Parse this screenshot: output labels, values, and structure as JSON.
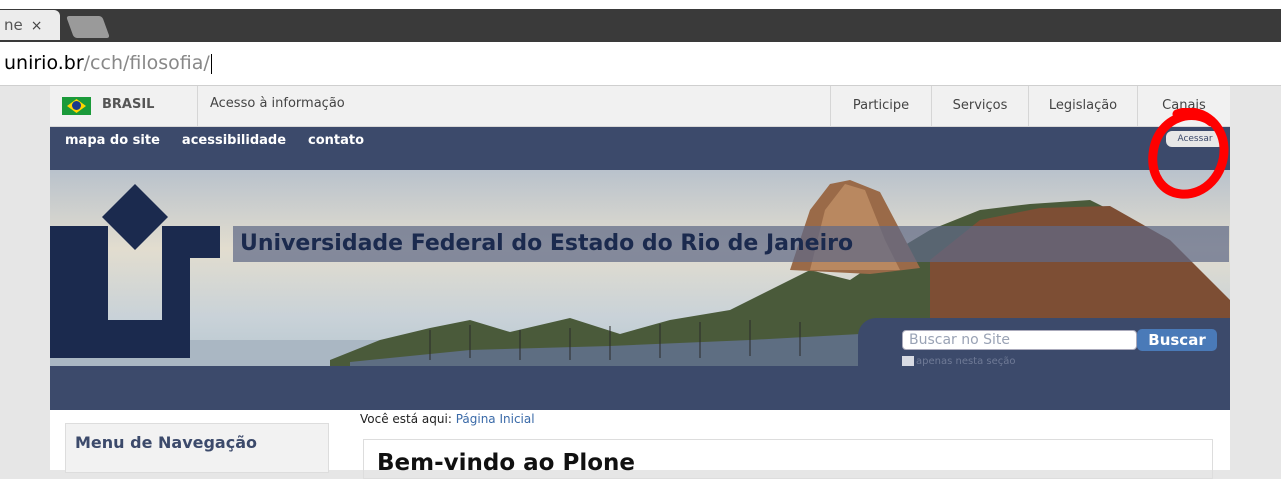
{
  "browser": {
    "tab_label": "ne",
    "tab_close": "×",
    "url_domain": "unirio.br",
    "url_path": "/cch/filosofia/"
  },
  "govbar": {
    "brasil_label": "BRASIL",
    "acesso_label": "Acesso à informação",
    "links": [
      "Participe",
      "Serviços",
      "Legislação",
      "Canais"
    ]
  },
  "header": {
    "top_links": [
      "mapa do site",
      "acessibilidade",
      "contato"
    ],
    "acessar_label": "Acessar",
    "site_title": "Universidade Federal do Estado do Rio de Janeiro"
  },
  "search": {
    "placeholder": "Buscar no Site",
    "button_label": "Buscar",
    "checkbox_label": "apenas nesta seção"
  },
  "content": {
    "breadcrumb_prefix": "Você está aqui:",
    "breadcrumb_link": "Página Inicial",
    "nav_menu_title": "Menu de Navegação",
    "welcome_title": "Bem-vindo ao Plone"
  },
  "colors": {
    "header_bg": "#3c4a6b",
    "accent": "#4a7ab8",
    "annotation": "#ff0000"
  }
}
